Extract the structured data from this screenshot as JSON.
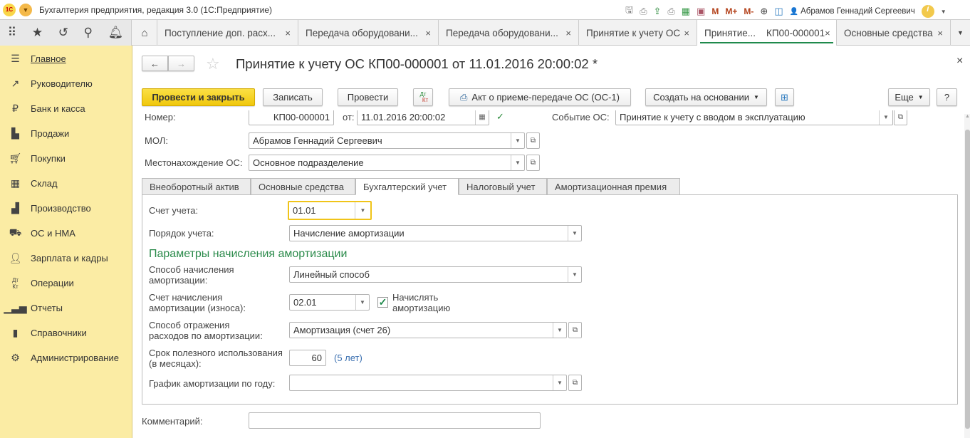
{
  "window": {
    "title": "Бухгалтерия предприятия, редакция 3.0  (1С:Предприятие)",
    "user": "Абрамов Геннадий Сергеевич",
    "logo": "1С",
    "toolbar_m": [
      "M",
      "M+",
      "M-"
    ]
  },
  "tabs": [
    {
      "label": "Поступление доп. расх..."
    },
    {
      "label": "Передача оборудовани..."
    },
    {
      "label": "Передача оборудовани..."
    },
    {
      "label": "Принятие к учету ОС"
    },
    {
      "label": "Принятие...    КП00-000001",
      "active": true
    },
    {
      "label": "Основные средства"
    }
  ],
  "sidebar": {
    "items": [
      {
        "label": "Главное",
        "icon": "menu-icon"
      },
      {
        "label": "Руководителю",
        "icon": "trend-icon"
      },
      {
        "label": "Банк и касса",
        "icon": "ruble-icon"
      },
      {
        "label": "Продажи",
        "icon": "bag-icon"
      },
      {
        "label": "Покупки",
        "icon": "cart-icon"
      },
      {
        "label": "Склад",
        "icon": "warehouse-icon"
      },
      {
        "label": "Производство",
        "icon": "factory-icon"
      },
      {
        "label": "ОС и НМА",
        "icon": "truck-icon"
      },
      {
        "label": "Зарплата и кадры",
        "icon": "person-icon"
      },
      {
        "label": "Операции",
        "icon": "dt-kt-icon"
      },
      {
        "label": "Отчеты",
        "icon": "bar-chart-icon"
      },
      {
        "label": "Справочники",
        "icon": "books-icon"
      },
      {
        "label": "Администрирование",
        "icon": "gear-icon"
      }
    ]
  },
  "form": {
    "title": "Принятие к учету ОС КП00-000001 от 11.01.2016 20:00:02 *",
    "buttons": {
      "post_close": "Провести и закрыть",
      "save": "Записать",
      "post": "Провести",
      "dtkt_top": "Дт",
      "dtkt_bottom": "Кт",
      "act": "Акт о приеме-передаче ОС (ОС-1)",
      "create_based": "Создать на основании",
      "more": "Еще",
      "help": "?"
    },
    "number_label": "Номер:",
    "number": "КП00-000001",
    "date_label": "от:",
    "date": "11.01.2016 20:00:02",
    "event_label": "Событие ОС:",
    "event": "Принятие к учету с вводом в эксплуатацию",
    "mol_label": "МОЛ:",
    "mol": "Абрамов Геннадий Сергеевич",
    "location_label": "Местонахождение ОС:",
    "location": "Основное подразделение",
    "tabs": [
      "Внеоборотный актив",
      "Основные средства",
      "Бухгалтерский учет",
      "Налоговый учет",
      "Амортизационная премия"
    ],
    "accounting": {
      "account_label": "Счет учета:",
      "account": "01.01",
      "order_label": "Порядок учета:",
      "order": "Начисление амортизации",
      "section": "Параметры начисления амортизации",
      "method_label1": "Способ начисления",
      "method_label2": "амортизации:",
      "method": "Линейный способ",
      "dep_account_label1": "Счет начисления",
      "dep_account_label2": "амортизации (износа):",
      "dep_account": "02.01",
      "accrue_label1": "Начислять",
      "accrue_label2": "амортизацию",
      "accrue_checked": true,
      "expense_label1": "Способ отражения",
      "expense_label2": "расходов по амортизации:",
      "expense": "Амортизация (счет 26)",
      "life_label1": "Срок полезного использования",
      "life_label2": "(в месяцах):",
      "life": "60",
      "life_hint": "(5 лет)",
      "schedule_label": "График амортизации по году:",
      "schedule": ""
    },
    "comment_label": "Комментарий:",
    "comment": ""
  }
}
